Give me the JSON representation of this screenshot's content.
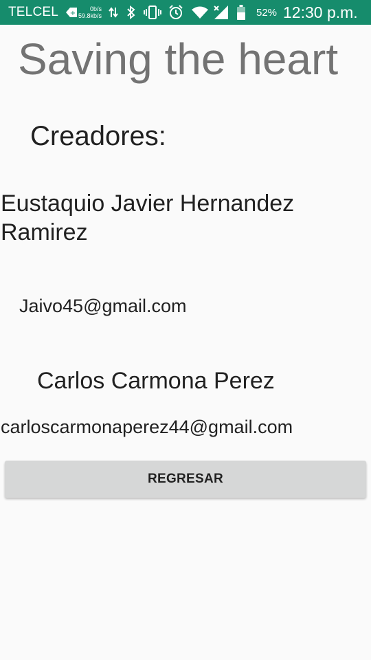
{
  "status_bar": {
    "carrier": "TELCEL",
    "net_speed_up": "0b/s",
    "net_speed_down": "59.8kb/s",
    "battery_percent": "52%",
    "time": "12:30 p.m.",
    "background_color": "#168c6c",
    "icons": [
      "data-saver-icon",
      "data-transfer-arrows-icon",
      "bluetooth-icon",
      "vibrate-icon",
      "alarm-icon",
      "wifi-icon",
      "signal-no-data-icon",
      "battery-icon"
    ]
  },
  "main": {
    "title": "Saving the heart",
    "creators_heading": "Creadores:",
    "creators": [
      {
        "name": "Eustaquio Javier Hernandez Ramirez",
        "email": "Jaivo45@gmail.com"
      },
      {
        "name": "Carlos Carmona Perez",
        "email": "carloscarmonaperez44@gmail.com"
      }
    ],
    "back_button_label": "REGRESAR"
  }
}
